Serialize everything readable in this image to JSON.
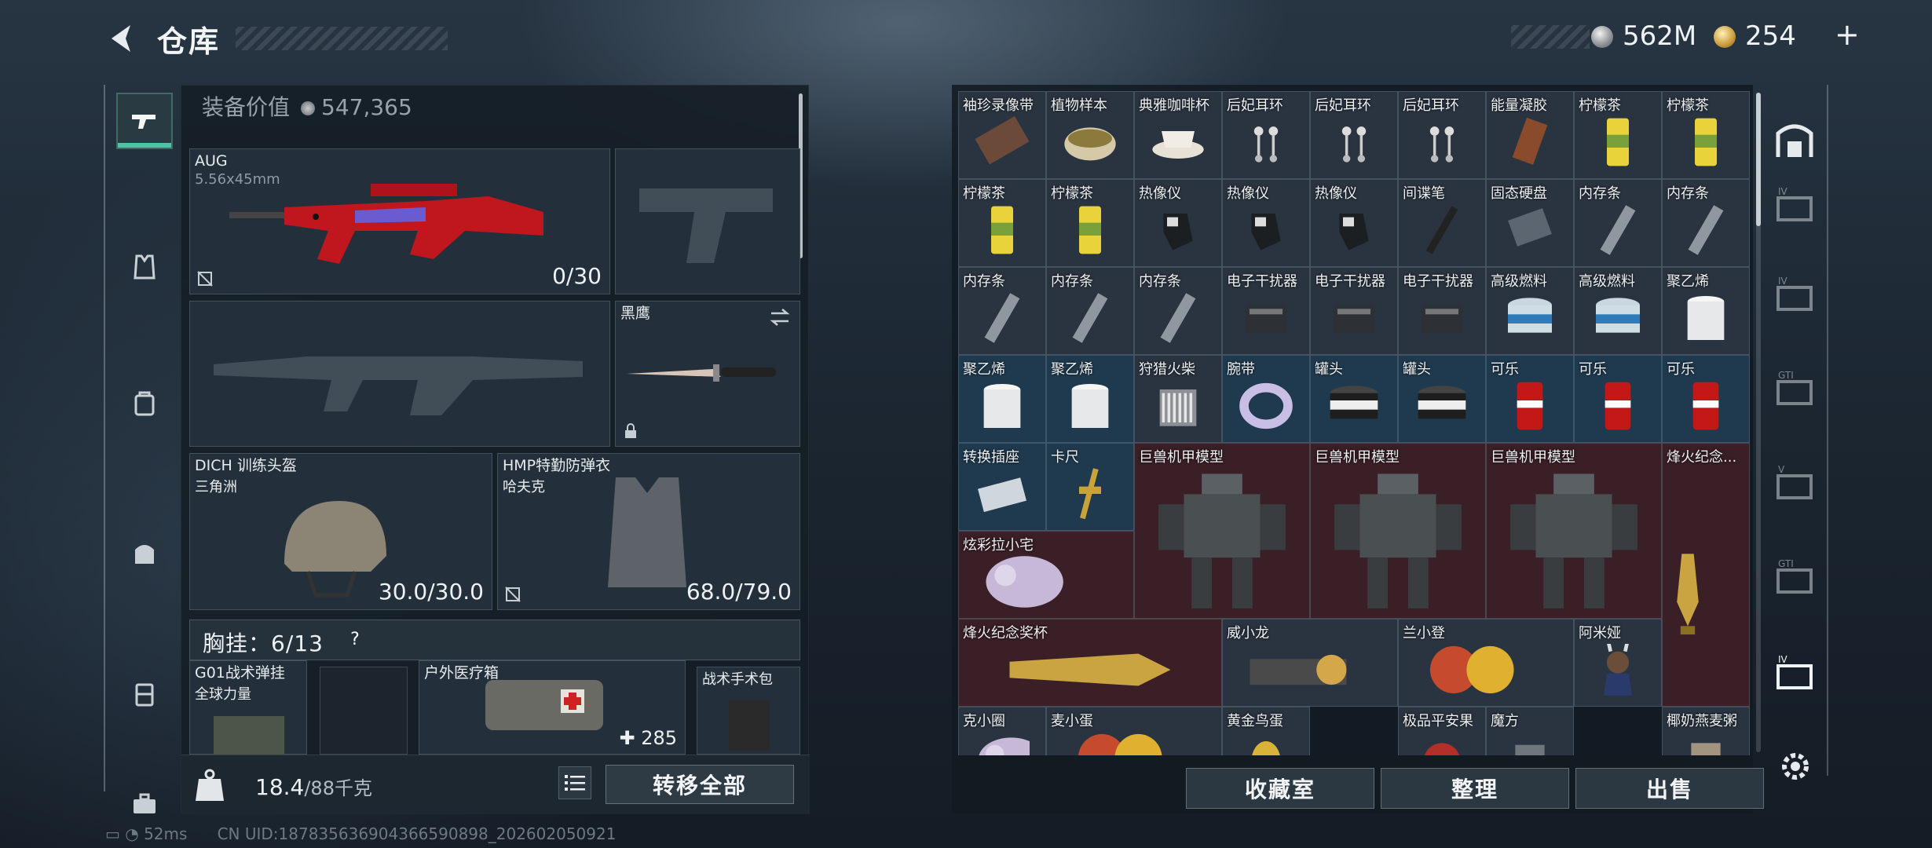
{
  "header": {
    "title": "仓库",
    "currency_silver": "562M",
    "currency_gold": "254",
    "gold_plus": "+"
  },
  "loadout": {
    "equip_value_label": "装备价值",
    "equip_value": "547,365",
    "primary": {
      "name": "AUG",
      "caliber": "5.56x45mm",
      "ammo": "0/30"
    },
    "melee": {
      "name": "黑鹰"
    },
    "helmet": {
      "name": "DICH 训练头盔",
      "sub": "三角洲",
      "durability": "30.0/30.0"
    },
    "armor": {
      "name": "HMP特勤防弹衣",
      "sub": "哈夫克",
      "durability": "68.0/79.0"
    },
    "chest_rig": "胸挂：6/13",
    "chest_q": "?",
    "pouches": [
      {
        "name": "G01战术弹挂",
        "sub": "全球力量"
      },
      {
        "name": "户外医疗箱",
        "count": "285"
      },
      {
        "name": "战术手术包"
      }
    ],
    "weight_value": "18.4",
    "weight_cap": "/88千克",
    "transfer_label": "转移全部"
  },
  "stash": {
    "items": [
      "袖珍录像带",
      "植物样本",
      "典雅咖啡杯",
      "后妃耳环",
      "后妃耳环",
      "后妃耳环",
      "能量凝胶",
      "柠檬茶",
      "柠檬茶",
      "柠檬茶",
      "柠檬茶",
      "热像仪",
      "热像仪",
      "热像仪",
      "间谍笔",
      "固态硬盘",
      "内存条",
      "内存条",
      "内存条",
      "内存条",
      "内存条",
      "电子干扰器",
      "电子干扰器",
      "电子干扰器",
      "高级燃料",
      "高级燃料",
      "聚乙烯",
      "聚乙烯",
      "聚乙烯",
      "狩猎火柴",
      "腕带",
      "罐头",
      "罐头",
      "可乐",
      "可乐",
      "可乐",
      "转换插座",
      "卡尺",
      "巨兽机甲模型",
      "巨兽机甲模型",
      "巨兽机甲模型",
      "烽火纪念...",
      "炫彩拉小宅",
      "烽火纪念奖杯",
      "威小龙",
      "兰小登",
      "阿米娅",
      "克小圈",
      "麦小蛋",
      "黄金鸟蛋",
      "极品平安果",
      "魔方",
      "椰奶燕麦粥"
    ],
    "buttons": {
      "collection": "收藏室",
      "organize": "整理",
      "sell": "出售"
    }
  },
  "status": {
    "ping": "52ms",
    "uid": "CN UID:18783563690436659089​8_202602050921"
  }
}
